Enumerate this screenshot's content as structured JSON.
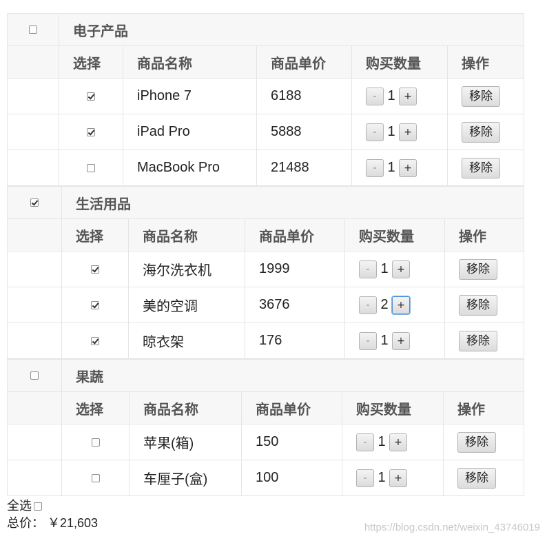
{
  "columns": {
    "select": "选择",
    "name": "商品名称",
    "price": "商品单价",
    "quantity": "购买数量",
    "action": "操作"
  },
  "buttons": {
    "minus": "-",
    "plus": "+",
    "remove": "移除"
  },
  "categories": [
    {
      "name": "电子产品",
      "checked": false,
      "items": [
        {
          "name": "iPhone 7",
          "price": "6188",
          "quantity": "1",
          "checked": true
        },
        {
          "name": "iPad Pro",
          "price": "5888",
          "quantity": "1",
          "checked": true
        },
        {
          "name": "MacBook Pro",
          "price": "21488",
          "quantity": "1",
          "checked": false
        }
      ]
    },
    {
      "name": "生活用品",
      "checked": true,
      "items": [
        {
          "name": "海尔洗衣机",
          "price": "1999",
          "quantity": "1",
          "checked": true
        },
        {
          "name": "美的空调",
          "price": "3676",
          "quantity": "2",
          "checked": true
        },
        {
          "name": "晾衣架",
          "price": "176",
          "quantity": "1",
          "checked": true
        }
      ]
    },
    {
      "name": "果蔬",
      "checked": false,
      "items": [
        {
          "name": "苹果(箱)",
          "price": "150",
          "quantity": "1",
          "checked": false
        },
        {
          "name": "车厘子(盒)",
          "price": "100",
          "quantity": "1",
          "checked": false
        }
      ]
    }
  ],
  "footer": {
    "select_all_label": "全选",
    "select_all_checked": false,
    "total_label": "总价：",
    "total_value": "￥21,603"
  },
  "watermark": "https://blog.csdn.net/weixin_43746019"
}
